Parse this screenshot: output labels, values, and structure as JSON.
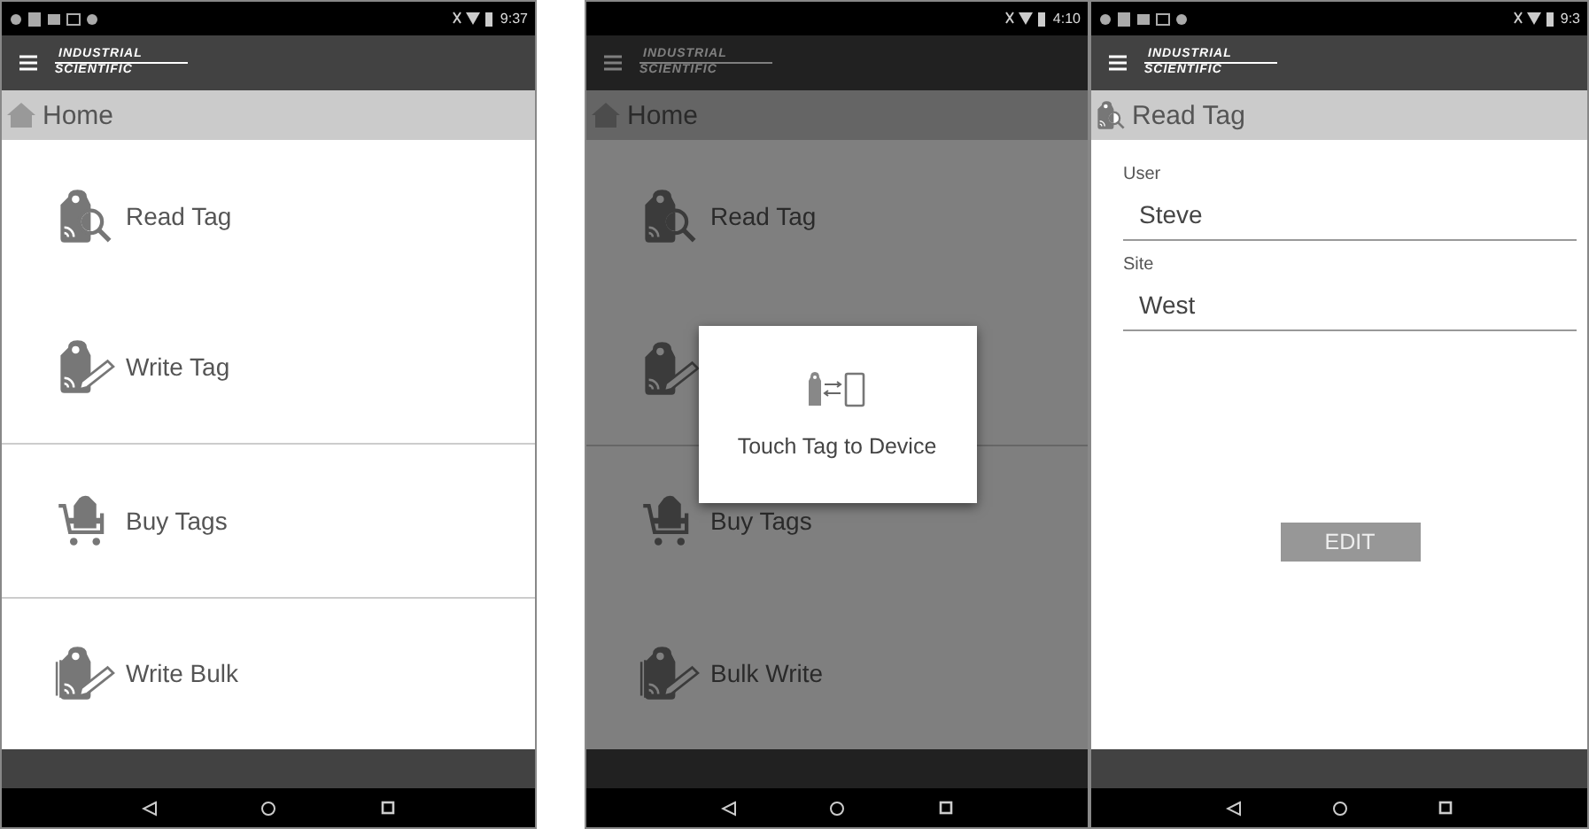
{
  "screens": [
    {
      "status_bar": {
        "time": "9:37",
        "notifications": true
      },
      "app_bar": {
        "logo_line_1": "INDUSTRIAL",
        "logo_line_2": "SCIENTIFIC"
      },
      "title_bar": {
        "title": "Home"
      },
      "dimmed": false,
      "content": {
        "kind": "menu",
        "items": [
          {
            "kind": "read",
            "label": "Read Tag",
            "divider_above": false
          },
          {
            "kind": "write",
            "label": "Write Tag",
            "divider_above": false
          },
          {
            "kind": "buy",
            "label": "Buy Tags",
            "divider_above": true
          },
          {
            "kind": "bulk",
            "label": "Write Bulk",
            "divider_above": true
          }
        ]
      }
    },
    {
      "status_bar": {
        "time": "4:10",
        "notifications": false
      },
      "app_bar": {
        "logo_line_1": "INDUSTRIAL",
        "logo_line_2": "SCIENTIFIC"
      },
      "title_bar": {
        "title": "Home"
      },
      "dimmed": true,
      "content": {
        "kind": "menu",
        "items": [
          {
            "kind": "read",
            "label": "Read Tag",
            "divider_above": false
          },
          {
            "kind": "write",
            "divider_above": false
          },
          {
            "kind": "buy",
            "label": "Buy Tags",
            "divider_above": true
          },
          {
            "kind": "bulk",
            "label": "Bulk Write",
            "divider_above": false
          }
        ]
      },
      "dialog": {
        "message": "Touch Tag to Device"
      }
    },
    {
      "status_bar": {
        "time": "9:3",
        "notifications": true
      },
      "app_bar": {
        "logo_line_1": "INDUSTRIAL",
        "logo_line_2": "SCIENTIFIC"
      },
      "title_bar": {
        "title": "Read Tag"
      },
      "dimmed": false,
      "content": {
        "kind": "form",
        "fields": [
          {
            "label": "User",
            "value": "Steve"
          },
          {
            "label": "Site",
            "value": "West"
          }
        ],
        "button": "EDIT"
      }
    }
  ]
}
